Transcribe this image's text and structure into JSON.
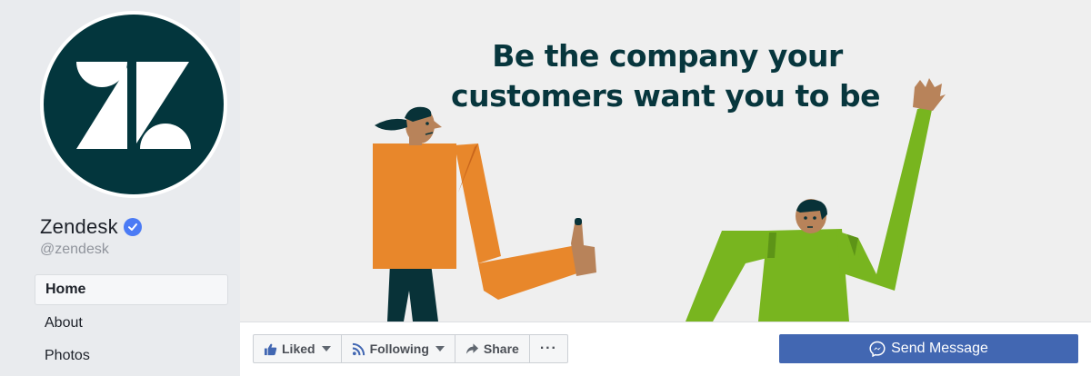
{
  "page": {
    "name": "Zendesk",
    "handle": "@zendesk",
    "brand_color": "#03363d",
    "verified": true
  },
  "nav": {
    "items": [
      {
        "label": "Home",
        "active": true
      },
      {
        "label": "About",
        "active": false
      },
      {
        "label": "Photos",
        "active": false
      }
    ]
  },
  "cover": {
    "headline_line1": "Be the company your",
    "headline_line2": "customers want you to be",
    "headline_color": "#07363d"
  },
  "actions": {
    "liked_label": "Liked",
    "following_label": "Following",
    "share_label": "Share",
    "more_label": "···",
    "send_message_label": "Send Message",
    "send_message_color": "#4267b2"
  },
  "icons": {
    "liked": "thumbs-up-icon",
    "following": "rss-icon",
    "share": "share-arrow-icon",
    "more": "more-dots-icon",
    "messenger": "messenger-icon",
    "verified": "verified-badge-icon"
  }
}
